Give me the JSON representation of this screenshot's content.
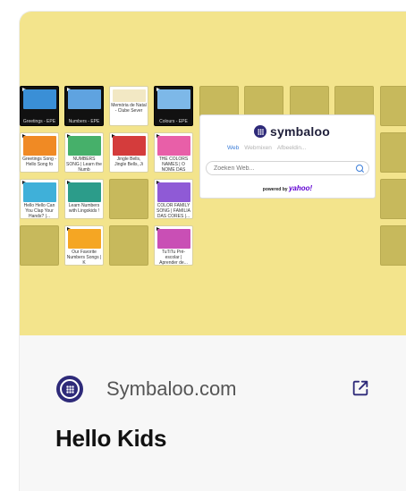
{
  "card": {
    "source_name": "Symbaloo.com",
    "title": "Hello Kids",
    "source_icon": "symbaloo-logo-icon",
    "external_icon": "external-link-icon"
  },
  "colors": {
    "preview_background": "#f3e48c",
    "empty_tile": "#c7b95c",
    "brand": "#2e2a79",
    "link_blue": "#3b7dd8",
    "yahoo_purple": "#6001d2"
  },
  "tiles": [
    {
      "caption": "Greetings - EPE",
      "thumb": "#3a8fd6",
      "dark": true
    },
    {
      "caption": "Numbers - EPE",
      "thumb": "#5fa3e0",
      "dark": true
    },
    {
      "caption": "Memória de Natal - Clube Sever",
      "thumb": "#f2e8c4",
      "dark": false
    },
    {
      "caption": "Colours - EPE",
      "thumb": "#7db8e8",
      "dark": true
    },
    {
      "caption": "Greetings Song - Hello Song fo",
      "thumb": "#f08a24",
      "dark": false
    },
    {
      "caption": "NUMBERS SONG | Learn the Numb",
      "thumb": "#46b06a",
      "dark": false
    },
    {
      "caption": "Jingle Bells, Jingle Bells, Ji",
      "thumb": "#d43c3c",
      "dark": false
    },
    {
      "caption": "THE COLORS NAMES | O NOME DAS",
      "thumb": "#e85fa8",
      "dark": false
    },
    {
      "caption": "Hello Hello Can You Clap Your Hands? |...",
      "thumb": "#3fb0d9",
      "dark": false
    },
    {
      "caption": "Learn Numbers with Lingokids !",
      "thumb": "#2c9c8a",
      "dark": false
    },
    {
      "caption": "COLOR FAMILY SONG | FAMILIA DAS CORES |...",
      "thumb": "#8f5ad6",
      "dark": false
    },
    {
      "caption": "Our Favorite Numbers Songs | K",
      "thumb": "#f5a623",
      "dark": false
    },
    {
      "caption": "TuTiTu Pré-escolar | Aprender de...",
      "thumb": "#c94fb5",
      "dark": false
    }
  ],
  "widget": {
    "brand": "symbaloo",
    "tabs": [
      "Web",
      "Webmixen",
      "Afbeeldin..."
    ],
    "search_placeholder": "Zoeken Web...",
    "powered_by": "powered by",
    "partner": "yahoo!"
  }
}
